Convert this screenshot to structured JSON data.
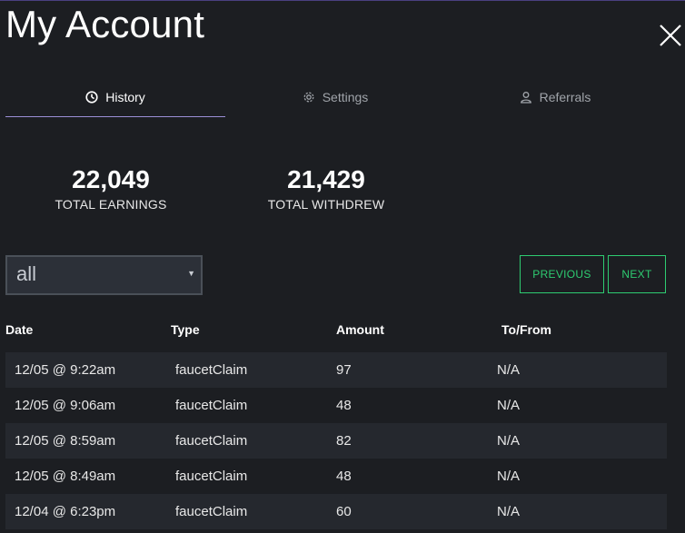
{
  "header": {
    "title": "My Account"
  },
  "tabs": [
    {
      "label": "History",
      "icon": "clock-icon",
      "active": true
    },
    {
      "label": "Settings",
      "icon": "gear-icon",
      "active": false
    },
    {
      "label": "Referrals",
      "icon": "user-icon",
      "active": false
    }
  ],
  "stats": {
    "earnings_value": "22,049",
    "earnings_label": "TOTAL EARNINGS",
    "withdrew_value": "21,429",
    "withdrew_label": "TOTAL WITHDREW"
  },
  "filter": {
    "selected": "all"
  },
  "pagination": {
    "previous_label": "PREVIOUS",
    "next_label": "NEXT"
  },
  "table": {
    "headers": {
      "date": "Date",
      "type": "Type",
      "amount": "Amount",
      "tofrom": "To/From"
    },
    "rows": [
      {
        "date": "12/05 @ 9:22am",
        "type": "faucetClaim",
        "amount": "97",
        "tofrom": "N/A"
      },
      {
        "date": "12/05 @ 9:06am",
        "type": "faucetClaim",
        "amount": "48",
        "tofrom": "N/A"
      },
      {
        "date": "12/05 @ 8:59am",
        "type": "faucetClaim",
        "amount": "82",
        "tofrom": "N/A"
      },
      {
        "date": "12/05 @ 8:49am",
        "type": "faucetClaim",
        "amount": "48",
        "tofrom": "N/A"
      },
      {
        "date": "12/04 @ 6:23pm",
        "type": "faucetClaim",
        "amount": "60",
        "tofrom": "N/A"
      }
    ]
  },
  "colors": {
    "background": "#1c1e22",
    "accent_green": "#2ecc71",
    "tab_underline": "#9b8fd6",
    "row_stripe": "#25282e"
  }
}
